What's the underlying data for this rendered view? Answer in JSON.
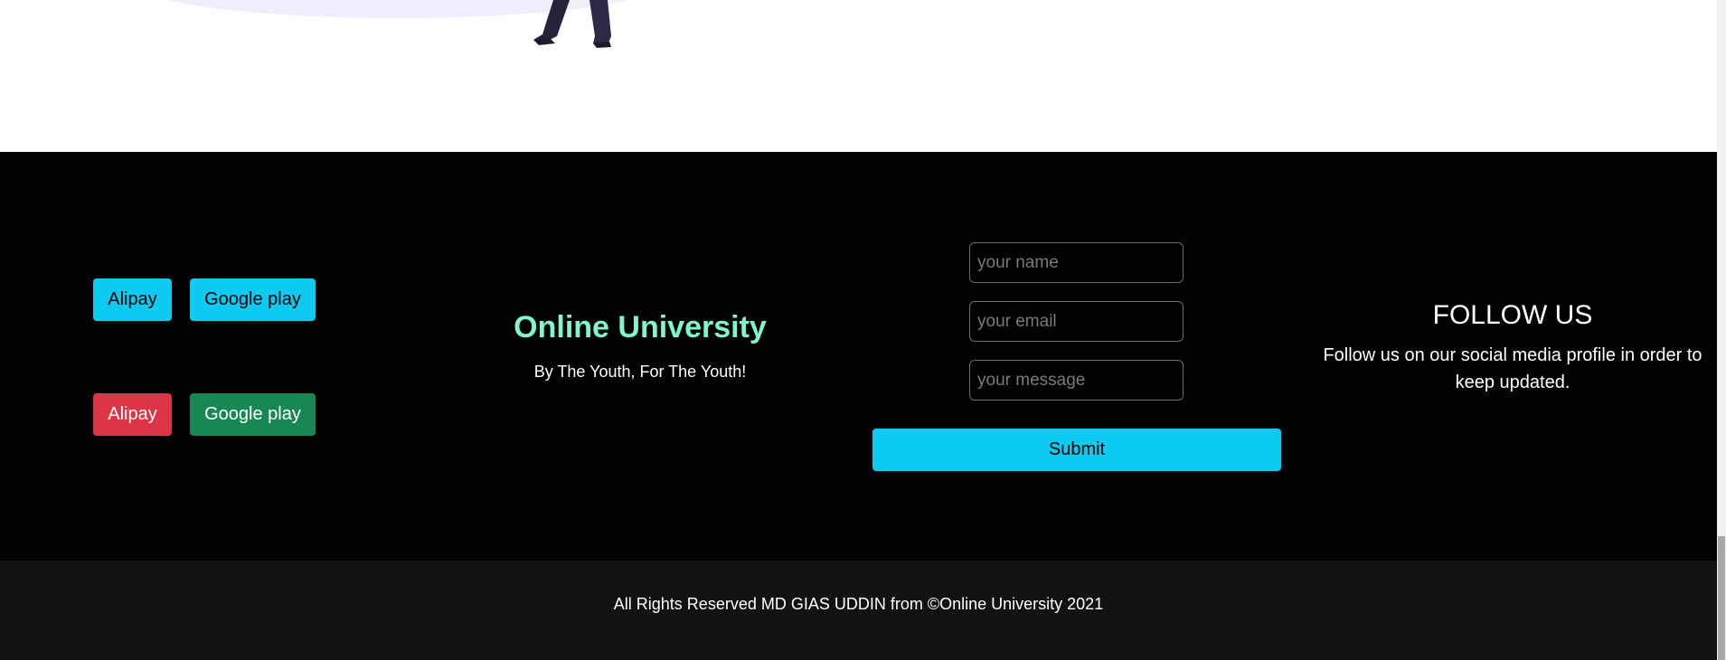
{
  "payment_buttons": {
    "row1": {
      "alipay": "Alipay",
      "google_play": "Google play"
    },
    "row2": {
      "alipay": "Alipay",
      "google_play": "Google play"
    }
  },
  "brand": {
    "title": "Online University",
    "tagline": "By The Youth, For The Youth!"
  },
  "contact_form": {
    "name_placeholder": "your name",
    "email_placeholder": "your email",
    "message_placeholder": "your message",
    "submit_label": "Submit"
  },
  "follow": {
    "title": "FOLLOW US",
    "text": "Follow us on our social media profile in order to keep updated."
  },
  "copyright": "All Rights Reserved MD GIAS UDDIN from ©Online University 2021",
  "colors": {
    "info": "#0dcaf0",
    "danger": "#dc3545",
    "success": "#198754",
    "brand": "#7ff5d0",
    "footer_bg": "#000000",
    "bottom_bar_bg": "#121212"
  }
}
